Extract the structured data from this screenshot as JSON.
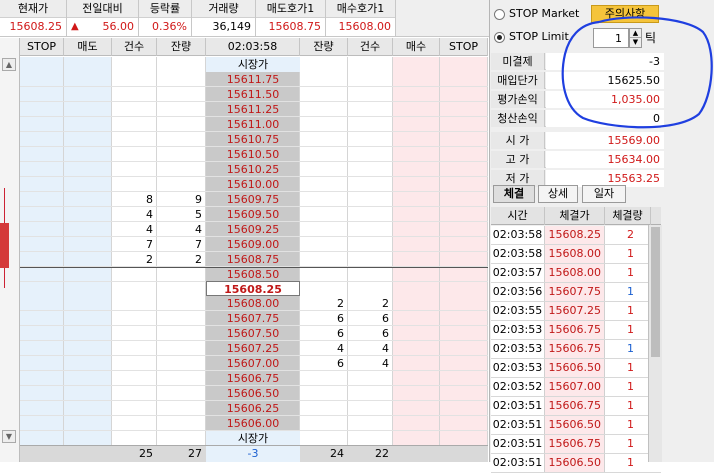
{
  "quote": {
    "headers": [
      "현재가",
      "전일대비",
      "등락률",
      "거래량",
      "매도호가1",
      "매수호가1"
    ],
    "current_price": "15608.25",
    "change_arrow": "▲",
    "change": "56.00",
    "change_rate": "0.36%",
    "volume": "36,149",
    "ask1": "15608.75",
    "bid1": "15608.00"
  },
  "orderbook": {
    "headers": {
      "stop_left": "STOP",
      "sell": "매도",
      "count1": "건수",
      "qty1": "잔량",
      "time": "02:03:58",
      "qty2": "잔량",
      "count2": "건수",
      "buy": "매수",
      "stop_right": "STOP"
    },
    "market_label": "시장가",
    "current_price": "15608.25",
    "ask_rows": [
      {
        "price": "15611.75",
        "count": "",
        "qty": ""
      },
      {
        "price": "15611.50",
        "count": "",
        "qty": ""
      },
      {
        "price": "15611.25",
        "count": "",
        "qty": ""
      },
      {
        "price": "15611.00",
        "count": "",
        "qty": ""
      },
      {
        "price": "15610.75",
        "count": "",
        "qty": ""
      },
      {
        "price": "15610.50",
        "count": "",
        "qty": ""
      },
      {
        "price": "15610.25",
        "count": "",
        "qty": ""
      },
      {
        "price": "15610.00",
        "count": "",
        "qty": ""
      },
      {
        "price": "15609.75",
        "count": "8",
        "qty": "9"
      },
      {
        "price": "15609.50",
        "count": "4",
        "qty": "5"
      },
      {
        "price": "15609.25",
        "count": "4",
        "qty": "4"
      },
      {
        "price": "15609.00",
        "count": "7",
        "qty": "7"
      },
      {
        "price": "15608.75",
        "count": "2",
        "qty": "2"
      },
      {
        "price": "15608.50",
        "count": "",
        "qty": ""
      }
    ],
    "bid_rows": [
      {
        "price": "15608.00",
        "qty": "2",
        "count": "2"
      },
      {
        "price": "15607.75",
        "qty": "6",
        "count": "6"
      },
      {
        "price": "15607.50",
        "qty": "6",
        "count": "6"
      },
      {
        "price": "15607.25",
        "qty": "4",
        "count": "4"
      },
      {
        "price": "15607.00",
        "qty": "6",
        "count": "4"
      },
      {
        "price": "15606.75",
        "qty": "",
        "count": ""
      },
      {
        "price": "15606.50",
        "qty": "",
        "count": ""
      },
      {
        "price": "15606.25",
        "qty": "",
        "count": ""
      },
      {
        "price": "15606.00",
        "qty": "",
        "count": ""
      }
    ],
    "footer": {
      "count1": "25",
      "qty1": "27",
      "diff": "-3",
      "qty2": "24",
      "count2": "22"
    }
  },
  "order_panel": {
    "stop_market_label": "STOP Market",
    "stop_limit_label": "STOP Limit",
    "notice_button": "주의사항",
    "tick_value": "1",
    "tick_unit": "틱"
  },
  "position": [
    {
      "label": "미결제",
      "value": "-3",
      "color": "#000000"
    },
    {
      "label": "매입단가",
      "value": "15625.50",
      "color": "#000000"
    },
    {
      "label": "평가손익",
      "value": "1,035.00",
      "color": "#d01818"
    },
    {
      "label": "청산손익",
      "value": "0",
      "color": "#000000"
    },
    {
      "label": "시 가",
      "value": "15569.00",
      "color": "#d01818"
    },
    {
      "label": "고 가",
      "value": "15634.00",
      "color": "#d01818"
    },
    {
      "label": "저 가",
      "value": "15563.25",
      "color": "#d01818"
    }
  ],
  "trade_tabs": [
    "체결",
    "상세",
    "일자"
  ],
  "trades": {
    "headers": [
      "시간",
      "체결가",
      "체결량"
    ],
    "rows": [
      {
        "time": "02:03:58",
        "price": "15608.25",
        "qty": "2",
        "side": "sell"
      },
      {
        "time": "02:03:58",
        "price": "15608.00",
        "qty": "1",
        "side": "sell"
      },
      {
        "time": "02:03:57",
        "price": "15608.00",
        "qty": "1",
        "side": "sell"
      },
      {
        "time": "02:03:56",
        "price": "15607.75",
        "qty": "1",
        "side": "buy"
      },
      {
        "time": "02:03:55",
        "price": "15607.25",
        "qty": "1",
        "side": "sell"
      },
      {
        "time": "02:03:53",
        "price": "15606.75",
        "qty": "1",
        "side": "sell"
      },
      {
        "time": "02:03:53",
        "price": "15606.75",
        "qty": "1",
        "side": "buy"
      },
      {
        "time": "02:03:53",
        "price": "15606.50",
        "qty": "1",
        "side": "sell"
      },
      {
        "time": "02:03:52",
        "price": "15607.00",
        "qty": "1",
        "side": "sell"
      },
      {
        "time": "02:03:51",
        "price": "15606.75",
        "qty": "1",
        "side": "sell"
      },
      {
        "time": "02:03:51",
        "price": "15606.50",
        "qty": "1",
        "side": "sell"
      },
      {
        "time": "02:03:51",
        "price": "15606.75",
        "qty": "1",
        "side": "sell"
      },
      {
        "time": "02:03:51",
        "price": "15606.50",
        "qty": "1",
        "side": "sell"
      }
    ]
  },
  "colors": {
    "up": "#d01818",
    "down": "#1a5fd0",
    "annotation_circle": "#1f3fe0",
    "price_column": "#c9c9c9",
    "ask_side": "#e6f1fb",
    "bid_side": "#fde8ea"
  }
}
